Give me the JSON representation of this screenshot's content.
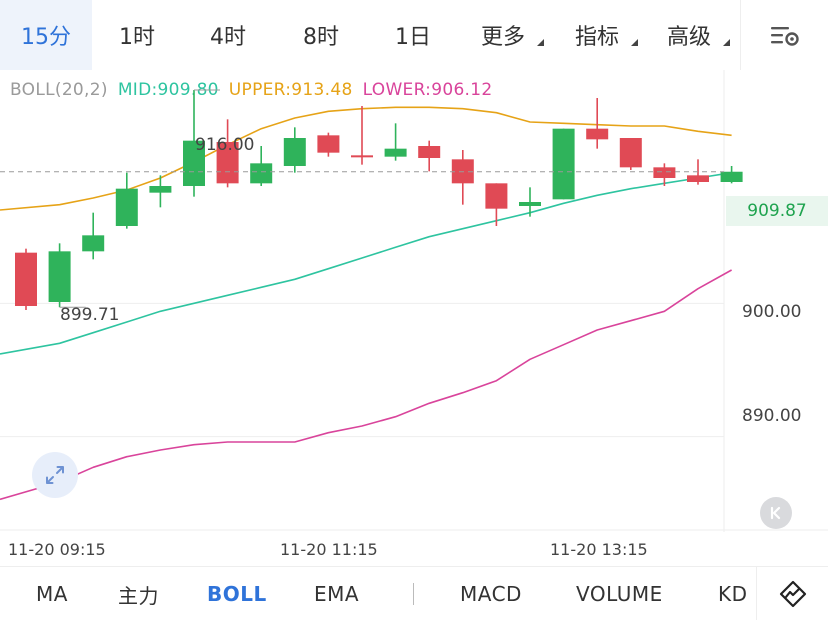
{
  "top_tabs": [
    {
      "label": "15分",
      "active": true
    },
    {
      "label": "1时",
      "active": false
    },
    {
      "label": "4时",
      "active": false
    },
    {
      "label": "8时",
      "active": false
    },
    {
      "label": "1日",
      "active": false
    },
    {
      "label": "更多",
      "active": false,
      "dropdown": true
    },
    {
      "label": "指标",
      "active": false,
      "dropdown": true
    },
    {
      "label": "高级",
      "active": false,
      "dropdown": true
    }
  ],
  "settings_icon": "chart-settings-icon",
  "legend": {
    "name": "BOLL(20,2)",
    "mid": "MID:909.80",
    "upper": "UPPER:913.48",
    "lower": "LOWER:906.12",
    "colors": {
      "name": "#9a9a9a",
      "mid": "#2ec4a0",
      "upper": "#e6a317",
      "lower": "#d9449b"
    }
  },
  "price_axis": {
    "labels": [
      "900.00",
      "890.00"
    ],
    "current_price": "909.87"
  },
  "annotations": {
    "high": "916.00",
    "low": "899.71"
  },
  "time_axis": [
    "11-20 09:15",
    "11-20 11:15",
    "11-20 13:15"
  ],
  "colors": {
    "up": "#2fb35b",
    "down": "#e04a55",
    "current_price": "#1fa34f",
    "accent": "#2f73d9"
  },
  "chart_data": {
    "type": "candlestick",
    "title": "",
    "candles": [
      {
        "open": 903.8,
        "close": 899.8,
        "high": 904.1,
        "low": 899.5
      },
      {
        "open": 900.1,
        "close": 903.9,
        "high": 904.5,
        "low": 899.71
      },
      {
        "open": 903.9,
        "close": 905.1,
        "high": 906.8,
        "low": 903.3
      },
      {
        "open": 905.8,
        "close": 908.6,
        "high": 909.8,
        "low": 905.6
      },
      {
        "open": 908.3,
        "close": 908.8,
        "high": 909.6,
        "low": 907.2
      },
      {
        "open": 908.8,
        "close": 912.2,
        "high": 916.0,
        "low": 908.0
      },
      {
        "open": 912.1,
        "close": 909.0,
        "high": 913.8,
        "low": 908.7
      },
      {
        "open": 909.0,
        "close": 910.5,
        "high": 911.8,
        "low": 908.8
      },
      {
        "open": 910.3,
        "close": 912.4,
        "high": 913.2,
        "low": 909.8
      },
      {
        "open": 912.6,
        "close": 911.3,
        "high": 912.8,
        "low": 911.0
      },
      {
        "open": 911.1,
        "close": 911.0,
        "high": 914.8,
        "low": 910.4
      },
      {
        "open": 911.0,
        "close": 911.6,
        "high": 913.5,
        "low": 910.7
      },
      {
        "open": 911.8,
        "close": 910.9,
        "high": 912.2,
        "low": 909.9
      },
      {
        "open": 910.8,
        "close": 909.0,
        "high": 911.5,
        "low": 907.4
      },
      {
        "open": 909.0,
        "close": 907.1,
        "high": 909.0,
        "low": 905.8
      },
      {
        "open": 907.3,
        "close": 907.6,
        "high": 908.7,
        "low": 906.5
      },
      {
        "open": 907.8,
        "close": 913.1,
        "high": 913.1,
        "low": 907.8
      },
      {
        "open": 913.1,
        "close": 912.3,
        "high": 915.4,
        "low": 911.6
      },
      {
        "open": 912.4,
        "close": 910.2,
        "high": 912.4,
        "low": 910.0
      },
      {
        "open": 910.2,
        "close": 909.4,
        "high": 910.5,
        "low": 908.8
      },
      {
        "open": 909.6,
        "close": 909.1,
        "high": 910.8,
        "low": 908.9
      },
      {
        "open": 909.1,
        "close": 909.87,
        "high": 910.3,
        "low": 909.0
      }
    ],
    "series": [
      {
        "name": "UPPER",
        "color": "#e6a317",
        "values": [
          907.0,
          907.4,
          907.9,
          908.5,
          909.4,
          910.6,
          911.9,
          913.1,
          913.9,
          914.4,
          914.6,
          914.7,
          914.7,
          914.6,
          914.3,
          913.6,
          913.5,
          913.4,
          913.3,
          913.3,
          912.9,
          912.6
        ]
      },
      {
        "name": "MID",
        "color": "#2ec4a0",
        "values": [
          896.2,
          897.0,
          897.8,
          898.6,
          899.4,
          900.0,
          900.6,
          901.2,
          901.8,
          902.6,
          903.4,
          904.2,
          905.0,
          905.6,
          906.2,
          906.8,
          907.5,
          908.1,
          908.6,
          909.0,
          909.4,
          909.8
        ]
      },
      {
        "name": "LOWER",
        "color": "#d9449b",
        "values": [
          885.3,
          886.6,
          887.7,
          888.5,
          889.0,
          889.4,
          889.6,
          889.6,
          889.6,
          890.3,
          890.8,
          891.5,
          892.5,
          893.3,
          894.2,
          895.8,
          896.9,
          898.0,
          898.7,
          899.4,
          901.1,
          902.5
        ]
      }
    ],
    "ylim": [
      883.0,
      917.5
    ],
    "current_price": 909.87
  }
}
